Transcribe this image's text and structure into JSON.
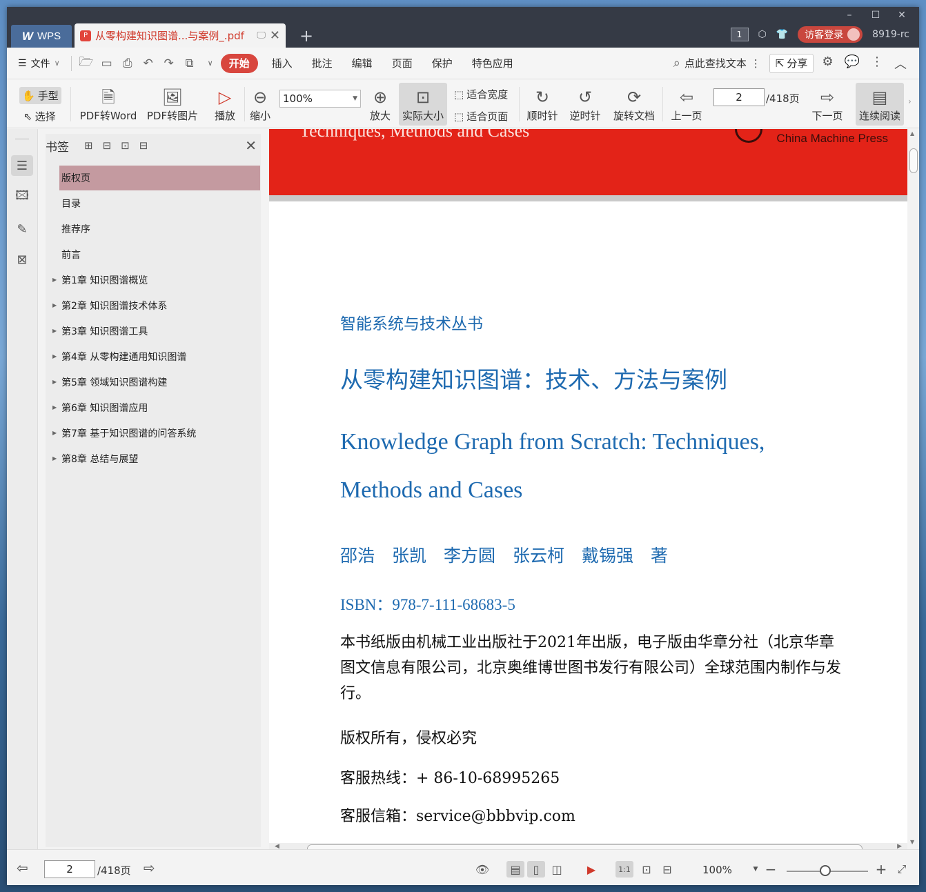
{
  "titlebar": {
    "app_tab": "WPS",
    "doc_tab_title": "从零构建知识图谱...与案例_.pdf",
    "new_tab": "+",
    "window_badge": "1",
    "login_label": "访客登录",
    "user_id": "8919-rc",
    "window_controls": [
      "–",
      "☐",
      "✕"
    ]
  },
  "menubar": {
    "file": "文件",
    "tabs": [
      "开始",
      "插入",
      "批注",
      "编辑",
      "页面",
      "保护",
      "特色应用"
    ],
    "search_label": "点此查找文本",
    "share_label": "分享"
  },
  "ribbon": {
    "hand": "手型",
    "select": "选择",
    "pdf_to_word": "PDF转Word",
    "pdf_to_image": "PDF转图片",
    "play": "播放",
    "zoom_out": "缩小",
    "zoom_value": "100%",
    "zoom_in": "放大",
    "actual_size": "实际大小",
    "fit_width": "适合宽度",
    "fit_page": "适合页面",
    "clockwise": "顺时针",
    "counterclockwise": "逆时针",
    "rotate_doc": "旋转文档",
    "prev_page": "上一页",
    "page_current": "2",
    "page_total": "/418页",
    "next_page": "下一页",
    "continuous": "连续阅读"
  },
  "bookmarks": {
    "header": "书签",
    "items": [
      {
        "label": "版权页",
        "expandable": false,
        "selected": true
      },
      {
        "label": "目录",
        "expandable": false
      },
      {
        "label": "推荐序",
        "expandable": false
      },
      {
        "label": "前言",
        "expandable": false
      },
      {
        "label": "第1章 知识图谱概览",
        "expandable": true
      },
      {
        "label": "第2章 知识图谱技术体系",
        "expandable": true
      },
      {
        "label": "第3章 知识图谱工具",
        "expandable": true
      },
      {
        "label": "第4章 从零构建通用知识图谱",
        "expandable": true
      },
      {
        "label": "第5章 领域知识图谱构建",
        "expandable": true
      },
      {
        "label": "第6章 知识图谱应用",
        "expandable": true
      },
      {
        "label": "第7章 基于知识图谱的问答系统",
        "expandable": true
      },
      {
        "label": "第8章 总结与展望",
        "expandable": true
      }
    ]
  },
  "page": {
    "cover_fragment_en": "Techniques, Methods and Cases",
    "publisher_en": "China Machine Press",
    "series": "智能系统与技术丛书",
    "title_cn": "从零构建知识图谱：技术、方法与案例",
    "title_en_line1": "Knowledge Graph from Scratch: Techniques,",
    "title_en_line2": "Methods and Cases",
    "authors": "邵浩　张凯　李方圆　张云柯　戴锡强　著",
    "isbn": "ISBN：978-7-111-68683-5",
    "description": "本书纸版由机械工业出版社于2021年出版，电子版由华章分社（北京华章图文信息有限公司，北京奥维博世图书发行有限公司）全球范围内制作与发行。",
    "rights": "版权所有，侵权必究",
    "hotline": "客服热线：+ 86-10-68995265",
    "email": "客服信箱：service@bbbvip.com"
  },
  "statusbar": {
    "page_current": "2",
    "page_total": "/418页",
    "zoom": "100%"
  },
  "colors": {
    "accent_red": "#d8463e",
    "title_blue": "#1e6ab0",
    "cover_red": "#e32318",
    "bookmark_selected": "#c49aa0"
  }
}
